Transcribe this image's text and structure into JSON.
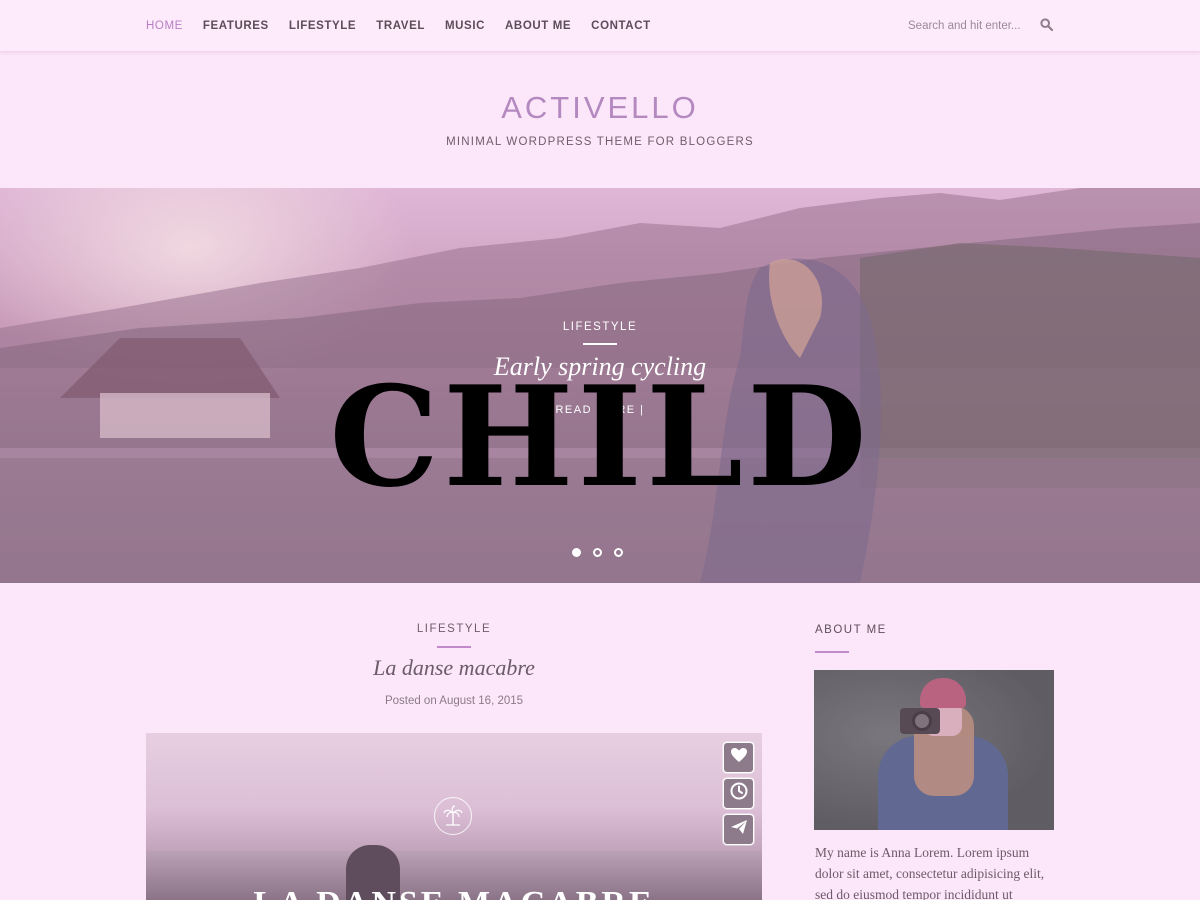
{
  "nav": {
    "items": [
      "HOME",
      "FEATURES",
      "LIFESTYLE",
      "TRAVEL",
      "MUSIC",
      "ABOUT ME",
      "CONTACT"
    ],
    "search_placeholder": "Search and hit enter..."
  },
  "brand": {
    "title": "ACTIVELLO",
    "tagline": "MINIMAL WORDPRESS THEME FOR BLOGGERS"
  },
  "hero": {
    "category": "LIFESTYLE",
    "title": "Early spring cycling",
    "read_more": "READ MORE |",
    "stamp": "CHILD",
    "slides": 3,
    "active_slide": 1
  },
  "post": {
    "category": "LIFESTYLE",
    "title": "La danse macabre",
    "meta": "Posted on August 16, 2015",
    "image_overlay": "LA DANSE MACABRE"
  },
  "sidebar": {
    "heading": "ABOUT ME",
    "text": "My name is Anna Lorem. Lorem ipsum dolor sit amet, consectetur adipisicing elit, sed do eiusmod tempor incididunt ut"
  },
  "colors": {
    "background": "#fce6f9",
    "accent": "#c08acb",
    "brand": "#b389c0"
  }
}
